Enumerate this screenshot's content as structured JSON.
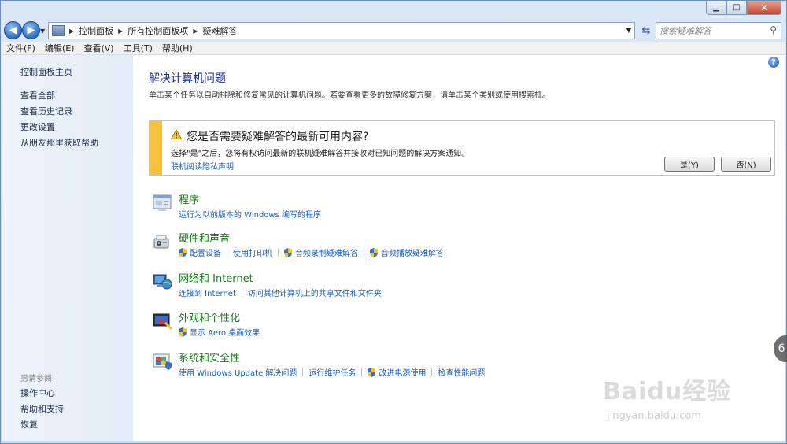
{
  "window": {
    "caption": {
      "minimize": "▁",
      "maximize": "□",
      "close": "✕"
    }
  },
  "nav": {
    "back_icon": "arrow-left-icon",
    "forward_icon": "arrow-right-icon",
    "breadcrumb": [
      "控制面板",
      "所有控制面板项",
      "疑难解答"
    ],
    "search_placeholder": "搜索疑难解答"
  },
  "menu": [
    "文件(F)",
    "编辑(E)",
    "查看(V)",
    "工具(T)",
    "帮助(H)"
  ],
  "sidebar": {
    "links": [
      "控制面板主页",
      "查看全部",
      "查看历史记录",
      "更改设置",
      "从朋友那里获取帮助"
    ],
    "see_also_heading": "另请参阅",
    "see_also": [
      "操作中心",
      "帮助和支持",
      "恢复"
    ]
  },
  "main": {
    "title": "解决计算机问题",
    "description": "单击某个任务以自动排除和修复常见的计算机问题。若要查看更多的故障修复方案，请单击某个类别或使用搜索框。",
    "notice": {
      "title": "您是否需要疑难解答的最新可用内容?",
      "text": "选择\"是\"之后，您将有权访问最新的联机疑难解答并接收对已知问题的解决方案通知。",
      "link": "联机阅读隐私声明",
      "yes": "是(Y)",
      "no": "否(N)",
      "accent": "#F6C23E"
    },
    "categories": [
      {
        "title": "程序",
        "icon": "programs-icon",
        "links": [
          {
            "label": "运行为以前版本的 Windows 编写的程序",
            "shield": false
          }
        ]
      },
      {
        "title": "硬件和声音",
        "icon": "hardware-sound-icon",
        "links": [
          {
            "label": "配置设备",
            "shield": true
          },
          {
            "label": "使用打印机",
            "shield": false
          },
          {
            "label": "音频录制疑难解答",
            "shield": true
          },
          {
            "label": "音频播放疑难解答",
            "shield": true
          }
        ]
      },
      {
        "title": "网络和 Internet",
        "icon": "network-icon",
        "links": [
          {
            "label": "连接到 Internet",
            "shield": false
          },
          {
            "label": "访问其他计算机上的共享文件和文件夹",
            "shield": false
          }
        ]
      },
      {
        "title": "外观和个性化",
        "icon": "appearance-icon",
        "links": [
          {
            "label": "显示 Aero 桌面效果",
            "shield": true
          }
        ]
      },
      {
        "title": "系统和安全性",
        "icon": "system-security-icon",
        "links": [
          {
            "label": "使用 Windows Update 解决问题",
            "shield": false
          },
          {
            "label": "运行维护任务",
            "shield": false
          },
          {
            "label": "改进电源使用",
            "shield": true
          },
          {
            "label": "检查性能问题",
            "shield": false
          }
        ]
      }
    ],
    "title_color": "#1E3287",
    "category_color": "#1B7A1B",
    "link_color": "#1A5FB4"
  },
  "watermark": {
    "logo": "Baidu经验",
    "url": "jingyan.baidu.com",
    "badge": "6"
  }
}
